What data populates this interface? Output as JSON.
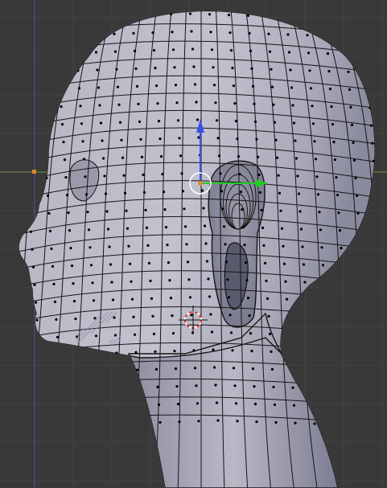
{
  "viewport": {
    "view": "side",
    "object": "head-mesh",
    "display_mode": "solid-with-wireframe",
    "colors": {
      "background": "#393939",
      "grid_line": "#444444",
      "mesh_fill": "#b9b9c4",
      "mesh_shadow": "#8a8a9c",
      "wire": "#1a1a1a",
      "vertex": "#000000",
      "x_axis_line": "#7a9a4a",
      "z_axis_line": "#5a5aa8",
      "gizmo_z": "#3a50e8",
      "gizmo_y": "#22cc22",
      "origin_dot": "#e08a2a",
      "cursor_ring_a": "#ee3333",
      "cursor_ring_b": "#ffffff"
    },
    "icons": [
      "transform-gizmo-icon",
      "3d-cursor-icon",
      "origin-marker-icon",
      "light-marker-icon"
    ]
  }
}
